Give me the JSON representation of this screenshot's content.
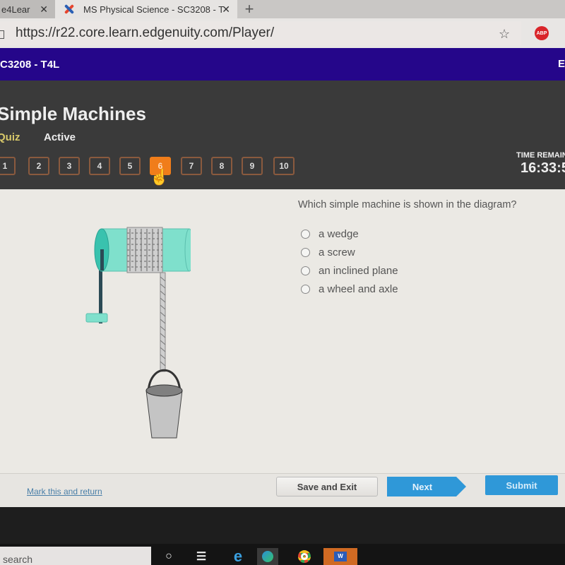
{
  "browser": {
    "tabs": [
      {
        "title": "e4Lear",
        "active": false
      },
      {
        "title": "MS Physical Science - SC3208 - T",
        "active": true
      }
    ],
    "new_tab_label": "+",
    "close_label": "✕",
    "url": "https://r22.core.learn.edgenuity.com/Player/",
    "favorites_icon": "☆",
    "abp_label": "ABP"
  },
  "course": {
    "code": "C3208 - T4L",
    "right_letter": "E"
  },
  "quiz": {
    "title": "Simple Machines",
    "type": "Quiz",
    "status": "Active",
    "questions": [
      "1",
      "2",
      "3",
      "4",
      "5",
      "6",
      "7",
      "8",
      "9",
      "10"
    ],
    "current_question": "6",
    "time_label": "TIME REMAIN",
    "time_value": "16:33:5"
  },
  "question": {
    "text": "Which simple machine is shown in the diagram?",
    "options": [
      "a wedge",
      "a screw",
      "an inclined plane",
      "a wheel and axle"
    ],
    "diagram": "wheel-and-axle well with rope and bucket"
  },
  "footer": {
    "mark_label": "Mark this and return",
    "save_label": "Save and Exit",
    "next_label": "Next",
    "submit_label": "Submit"
  },
  "taskbar": {
    "search_placeholder": "search",
    "icons": [
      "cortana-icon",
      "task-view-icon",
      "ie-icon",
      "edge-icon",
      "chrome-icon",
      "word-icon"
    ]
  },
  "colors": {
    "course_bar": "#25068a",
    "current_question": "#f07d1a",
    "primary_button": "#2f98d8",
    "drum": "#7fe0cc"
  }
}
